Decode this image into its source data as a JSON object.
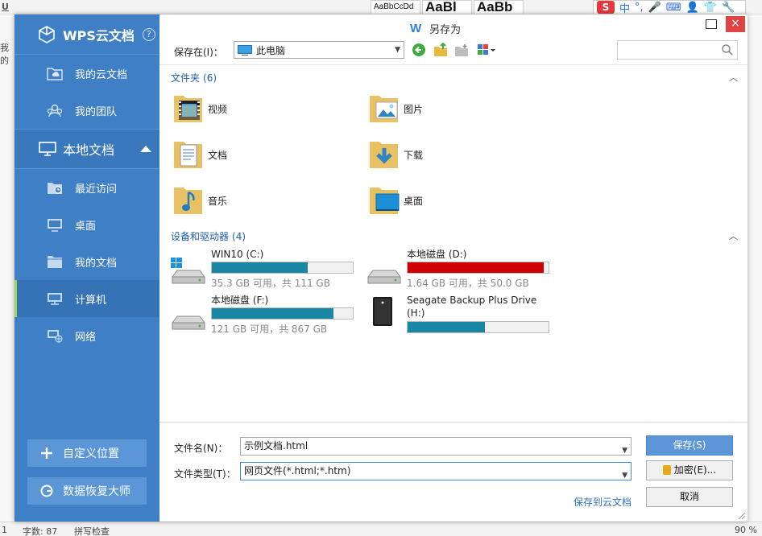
{
  "background": {
    "left_text": "我的",
    "style_boxes": [
      "AaBbCcDd",
      "AaBl",
      "AaBb"
    ],
    "status": {
      "page": "1",
      "word_count": "字数: 87",
      "spell": "拼写检查",
      "zoom": "90 %"
    },
    "ime": {
      "logo": "S",
      "mode": "中"
    }
  },
  "dialog": {
    "title": "另存为",
    "title_logo": "W",
    "close_label": "×",
    "sidebar": {
      "brand": "WPS云文档",
      "help": "?",
      "cloud_items": [
        {
          "label": "我的云文档",
          "icon": "cloud-folder-icon"
        },
        {
          "label": "我的团队",
          "icon": "team-icon"
        }
      ],
      "local_section": {
        "label": "本地文档",
        "icon": "monitor-icon"
      },
      "local_items": [
        {
          "label": "最近访问",
          "icon": "recent-folder-icon"
        },
        {
          "label": "桌面",
          "icon": "desktop-icon"
        },
        {
          "label": "我的文档",
          "icon": "folder-icon"
        },
        {
          "label": "计算机",
          "icon": "computer-icon",
          "active": true
        },
        {
          "label": "网络",
          "icon": "network-icon"
        }
      ],
      "custom_location": "自定义位置",
      "data_recovery": "数据恢复大师"
    },
    "toolbar": {
      "save_in_label": "保存在(I)：",
      "location": "此电脑",
      "search_placeholder": ""
    },
    "folders_header": {
      "label": "文件夹",
      "count": "(6)"
    },
    "folders": [
      {
        "name": "视频",
        "icon": "video-folder-icon"
      },
      {
        "name": "图片",
        "icon": "pictures-folder-icon"
      },
      {
        "name": "文档",
        "icon": "documents-folder-icon"
      },
      {
        "name": "下载",
        "icon": "downloads-folder-icon"
      },
      {
        "name": "音乐",
        "icon": "music-folder-icon"
      },
      {
        "name": "桌面",
        "icon": "desktop-folder-icon"
      }
    ],
    "drives_header": {
      "label": "设备和驱动器",
      "count": "(4)"
    },
    "drives": [
      {
        "name": "WIN10 (C:)",
        "size_text": "35.3 GB 可用，共 111 GB",
        "used_fraction": 0.68,
        "status_color": "#1a86a5",
        "icon": "windows-drive-icon"
      },
      {
        "name": "本地磁盘 (D:)",
        "size_text": "1.64 GB 可用，共 50.0 GB",
        "used_fraction": 0.967,
        "status_color": "#d00000",
        "icon": "hard-drive-icon"
      },
      {
        "name": "本地磁盘 (F:)",
        "size_text": "121 GB 可用，共 867 GB",
        "used_fraction": 0.86,
        "status_color": "#1a86a5",
        "icon": "hard-drive-icon"
      },
      {
        "name": "Seagate Backup Plus Drive (H:)",
        "size_text": "",
        "used_fraction": 0.55,
        "status_color": "#1a86a5",
        "icon": "external-drive-icon"
      }
    ],
    "bottom": {
      "filename_label": "文件名(N)：",
      "filename_value": "示例文档.html",
      "filetype_label": "文件类型(T)：",
      "filetype_value": "网页文件(*.html;*.htm)",
      "save_button": "保存(S)",
      "encrypt_button": "加密(E)...",
      "save_to_cloud": "保存到云文档",
      "cancel_button": "取消"
    }
  },
  "colors": {
    "sidebar": "#3e7fc6",
    "accent": "#5b97d6",
    "active_indicator": "#9fd15b",
    "close": "#e04343",
    "link": "#2f6fbf"
  }
}
